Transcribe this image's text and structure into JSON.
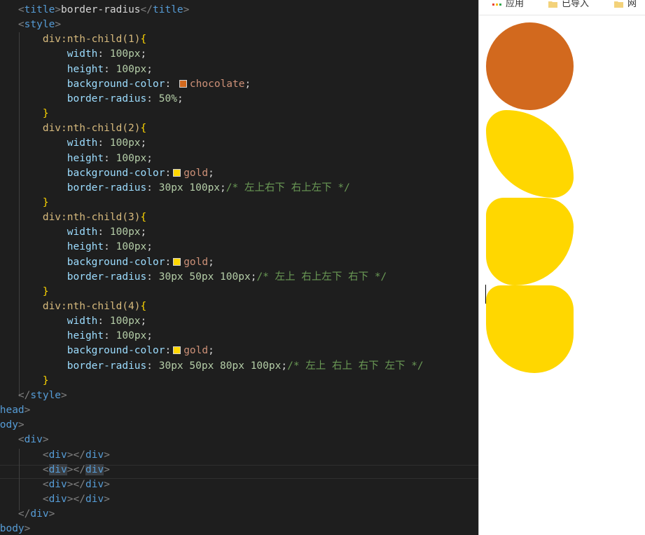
{
  "editor": {
    "lines": [
      [
        [
          "    ",
          "t-text"
        ],
        [
          "<",
          "t-br"
        ],
        [
          "title",
          "t-tag"
        ],
        [
          ">",
          "t-br"
        ],
        [
          "border-radius",
          "t-text"
        ],
        [
          "</",
          "t-br"
        ],
        [
          "title",
          "t-tag"
        ],
        [
          ">",
          "t-br"
        ]
      ],
      [
        [
          "    ",
          "t-text"
        ],
        [
          "<",
          "t-br"
        ],
        [
          "style",
          "t-tag"
        ],
        [
          ">",
          "t-br"
        ]
      ],
      [
        [
          "        div:nth-child(1)",
          "t-sel"
        ],
        [
          "{",
          "t-brace"
        ]
      ],
      [
        [
          "            ",
          "t-text"
        ],
        [
          "width",
          "t-prop"
        ],
        [
          ": ",
          "t-punct"
        ],
        [
          "100px",
          "t-num"
        ],
        [
          ";",
          "t-punct"
        ]
      ],
      [
        [
          "            ",
          "t-text"
        ],
        [
          "height",
          "t-prop"
        ],
        [
          ": ",
          "t-punct"
        ],
        [
          "100px",
          "t-num"
        ],
        [
          ";",
          "t-punct"
        ]
      ],
      [
        [
          "            ",
          "t-text"
        ],
        [
          "background-color",
          "t-prop"
        ],
        [
          ": ",
          "t-punct"
        ],
        [
          "#d2691e",
          "swatch"
        ],
        [
          "chocolate",
          "t-col"
        ],
        [
          ";",
          "t-punct"
        ]
      ],
      [
        [
          "            ",
          "t-text"
        ],
        [
          "border-radius",
          "t-prop"
        ],
        [
          ": ",
          "t-punct"
        ],
        [
          "50%",
          "t-num"
        ],
        [
          ";",
          "t-punct"
        ]
      ],
      [
        [
          "        ",
          "t-text"
        ],
        [
          "}",
          "t-brace"
        ]
      ],
      [
        [
          "        div:nth-child(2)",
          "t-sel"
        ],
        [
          "{",
          "t-brace"
        ]
      ],
      [
        [
          "            ",
          "t-text"
        ],
        [
          "width",
          "t-prop"
        ],
        [
          ": ",
          "t-punct"
        ],
        [
          "100px",
          "t-num"
        ],
        [
          ";",
          "t-punct"
        ]
      ],
      [
        [
          "            ",
          "t-text"
        ],
        [
          "height",
          "t-prop"
        ],
        [
          ": ",
          "t-punct"
        ],
        [
          "100px",
          "t-num"
        ],
        [
          ";",
          "t-punct"
        ]
      ],
      [
        [
          "            ",
          "t-text"
        ],
        [
          "background-color",
          "t-prop"
        ],
        [
          ":",
          "t-punct"
        ],
        [
          "#ffd700",
          "swatch"
        ],
        [
          "gold",
          "t-col"
        ],
        [
          ";",
          "t-punct"
        ]
      ],
      [
        [
          "            ",
          "t-text"
        ],
        [
          "border-radius",
          "t-prop"
        ],
        [
          ": ",
          "t-punct"
        ],
        [
          "30px",
          "t-num"
        ],
        [
          " ",
          "t-punct"
        ],
        [
          "100px",
          "t-num"
        ],
        [
          ";",
          "t-punct"
        ],
        [
          "/* 左上右下 右上左下 */",
          "t-cm"
        ]
      ],
      [
        [
          "        ",
          "t-text"
        ],
        [
          "}",
          "t-brace"
        ]
      ],
      [
        [
          "        div:nth-child(3)",
          "t-sel"
        ],
        [
          "{",
          "t-brace"
        ]
      ],
      [
        [
          "            ",
          "t-text"
        ],
        [
          "width",
          "t-prop"
        ],
        [
          ": ",
          "t-punct"
        ],
        [
          "100px",
          "t-num"
        ],
        [
          ";",
          "t-punct"
        ]
      ],
      [
        [
          "            ",
          "t-text"
        ],
        [
          "height",
          "t-prop"
        ],
        [
          ": ",
          "t-punct"
        ],
        [
          "100px",
          "t-num"
        ],
        [
          ";",
          "t-punct"
        ]
      ],
      [
        [
          "            ",
          "t-text"
        ],
        [
          "background-color",
          "t-prop"
        ],
        [
          ":",
          "t-punct"
        ],
        [
          "#ffd700",
          "swatch"
        ],
        [
          "gold",
          "t-col"
        ],
        [
          ";",
          "t-punct"
        ]
      ],
      [
        [
          "            ",
          "t-text"
        ],
        [
          "border-radius",
          "t-prop"
        ],
        [
          ": ",
          "t-punct"
        ],
        [
          "30px",
          "t-num"
        ],
        [
          " ",
          "t-punct"
        ],
        [
          "50px",
          "t-num"
        ],
        [
          " ",
          "t-punct"
        ],
        [
          "100px",
          "t-num"
        ],
        [
          ";",
          "t-punct"
        ],
        [
          "/* 左上 右上左下 右下 */",
          "t-cm"
        ]
      ],
      [
        [
          "        ",
          "t-text"
        ],
        [
          "}",
          "t-brace"
        ]
      ],
      [
        [
          "        div:nth-child(4)",
          "t-sel"
        ],
        [
          "{",
          "t-brace"
        ]
      ],
      [
        [
          "            ",
          "t-text"
        ],
        [
          "width",
          "t-prop"
        ],
        [
          ": ",
          "t-punct"
        ],
        [
          "100px",
          "t-num"
        ],
        [
          ";",
          "t-punct"
        ]
      ],
      [
        [
          "            ",
          "t-text"
        ],
        [
          "height",
          "t-prop"
        ],
        [
          ": ",
          "t-punct"
        ],
        [
          "100px",
          "t-num"
        ],
        [
          ";",
          "t-punct"
        ]
      ],
      [
        [
          "            ",
          "t-text"
        ],
        [
          "background-color",
          "t-prop"
        ],
        [
          ":",
          "t-punct"
        ],
        [
          "#ffd700",
          "swatch"
        ],
        [
          "gold",
          "t-col"
        ],
        [
          ";",
          "t-punct"
        ]
      ],
      [
        [
          "            ",
          "t-text"
        ],
        [
          "border-radius",
          "t-prop"
        ],
        [
          ": ",
          "t-punct"
        ],
        [
          "30px",
          "t-num"
        ],
        [
          " ",
          "t-punct"
        ],
        [
          "50px",
          "t-num"
        ],
        [
          " ",
          "t-punct"
        ],
        [
          "80px",
          "t-num"
        ],
        [
          " ",
          "t-punct"
        ],
        [
          "100px",
          "t-num"
        ],
        [
          ";",
          "t-punct"
        ],
        [
          "/* 左上 右上 右下 左下 */",
          "t-cm"
        ]
      ],
      [
        [
          "        ",
          "t-text"
        ],
        [
          "}",
          "t-brace"
        ]
      ],
      [
        [
          "    ",
          "t-text"
        ],
        [
          "</",
          "t-br"
        ],
        [
          "style",
          "t-tag"
        ],
        [
          ">",
          "t-br"
        ]
      ],
      [
        [
          "/",
          "t-br"
        ],
        [
          "head",
          "t-tag"
        ],
        [
          ">",
          "t-br"
        ]
      ],
      [
        [
          "body",
          "t-tag"
        ],
        [
          ">",
          "t-br"
        ]
      ],
      [
        [
          "    ",
          "t-text"
        ],
        [
          "<",
          "t-br"
        ],
        [
          "div",
          "t-tag"
        ],
        [
          ">",
          "t-br"
        ]
      ],
      [
        [
          "        ",
          "t-text"
        ],
        [
          "<",
          "t-br"
        ],
        [
          "div",
          "t-tag"
        ],
        [
          "></",
          "t-br"
        ],
        [
          "div",
          "t-tag"
        ],
        [
          ">",
          "t-br"
        ]
      ],
      [
        [
          "        ",
          "t-text"
        ],
        [
          "<",
          "t-br"
        ],
        [
          "div",
          "t-tag sel-word"
        ],
        [
          "></",
          "t-br"
        ],
        [
          "div",
          "t-tag sel-word"
        ],
        [
          ">",
          "t-br"
        ]
      ],
      [
        [
          "        ",
          "t-text"
        ],
        [
          "<",
          "t-br"
        ],
        [
          "div",
          "t-tag"
        ],
        [
          "></",
          "t-br"
        ],
        [
          "div",
          "t-tag"
        ],
        [
          ">",
          "t-br"
        ]
      ],
      [
        [
          "        ",
          "t-text"
        ],
        [
          "<",
          "t-br"
        ],
        [
          "div",
          "t-tag"
        ],
        [
          "></",
          "t-br"
        ],
        [
          "div",
          "t-tag"
        ],
        [
          ">",
          "t-br"
        ]
      ],
      [
        [
          "    ",
          "t-text"
        ],
        [
          "</",
          "t-br"
        ],
        [
          "div",
          "t-tag"
        ],
        [
          ">",
          "t-br"
        ]
      ],
      [
        [
          "/",
          "t-br"
        ],
        [
          "body",
          "t-tag"
        ],
        [
          ">",
          "t-br"
        ]
      ]
    ]
  },
  "browser": {
    "bookmarks": [
      {
        "label": "应用",
        "icon": "apps-grid-icon"
      },
      {
        "label": "已导入",
        "icon": "folder-icon"
      },
      {
        "label": "网",
        "icon": "folder-icon"
      }
    ],
    "shapes": [
      {
        "name": "shape-chocolate-circle",
        "color": "#d2691e",
        "radius": "50%"
      },
      {
        "name": "shape-gold-leaf",
        "color": "#ffd700",
        "radius": "30px 100px"
      },
      {
        "name": "shape-gold-three-value",
        "color": "#ffd700",
        "radius": "30px 50px 100px"
      },
      {
        "name": "shape-gold-four-value",
        "color": "#ffd700",
        "radius": "30px 50px 80px 100px"
      }
    ]
  }
}
